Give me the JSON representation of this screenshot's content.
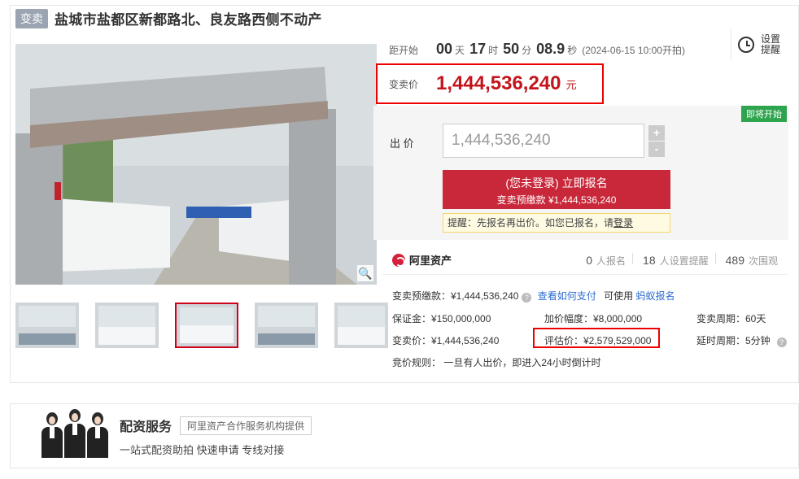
{
  "header": {
    "tag": "变卖",
    "title": "盐城市盐都区新都路北、良友路西侧不动产"
  },
  "gallery": {
    "zoom_icon": "search-icon",
    "thumbnail_count": 5,
    "active_thumbnail_index": 3
  },
  "countdown": {
    "label": "距开始",
    "days": "00",
    "days_unit": "天",
    "hours": "17",
    "hours_unit": "时",
    "minutes": "50",
    "minutes_unit": "分",
    "seconds": "08.9",
    "seconds_unit": "秒",
    "start_time": "(2024-06-15 10:00开拍)"
  },
  "reminder": {
    "label_line1": "设置",
    "label_line2": "提醒",
    "icon": "alarm-clock-icon"
  },
  "price": {
    "label": "变卖价",
    "value": "1,444,536,240",
    "unit": "元"
  },
  "bid": {
    "status_tag": "即将开始",
    "label": "出 价",
    "input_value": "1,444,536,240",
    "plus": "+",
    "minus": "-",
    "signup_main": "(您未登录) 立即报名",
    "signup_sub": "变卖预缴款 ¥1,444,536,240",
    "hint_text": "提醒：先报名再出价。如您已报名，请",
    "hint_link": "登录"
  },
  "stats": {
    "brand": "阿里资产",
    "signups_num": "0",
    "signups_label": "人报名",
    "reminders_num": "18",
    "reminders_label": "人设置提醒",
    "views_num": "489",
    "views_label": "次围观"
  },
  "details": {
    "deposit_text": "变卖预缴款：¥1,444,536,240",
    "how_to_pay": "查看如何支付",
    "can_use": "可使用",
    "ant_signup": "蚂蚁报名",
    "bond": "保证金：¥150,000,000",
    "increment": "加价幅度：¥8,000,000",
    "sale_period": "变卖周期：60天",
    "sale_price": "变卖价：¥1,444,536,240",
    "appraisal": "评估价：¥2,579,529,000",
    "delay_period": "延时周期：5分钟",
    "rules": "竞价规则：   一旦有人出价，即进入24小时倒计时"
  },
  "finance": {
    "title": "配资服务",
    "provider": "阿里资产合作服务机构提供",
    "desc": "一站式配资助拍  快速申请  专线对接"
  },
  "colors": {
    "accent_red": "#c4141b",
    "button_red": "#c8283a",
    "highlight_border": "#e00000",
    "soon_green": "#2ea44f",
    "link_blue": "#2a6bcf"
  }
}
